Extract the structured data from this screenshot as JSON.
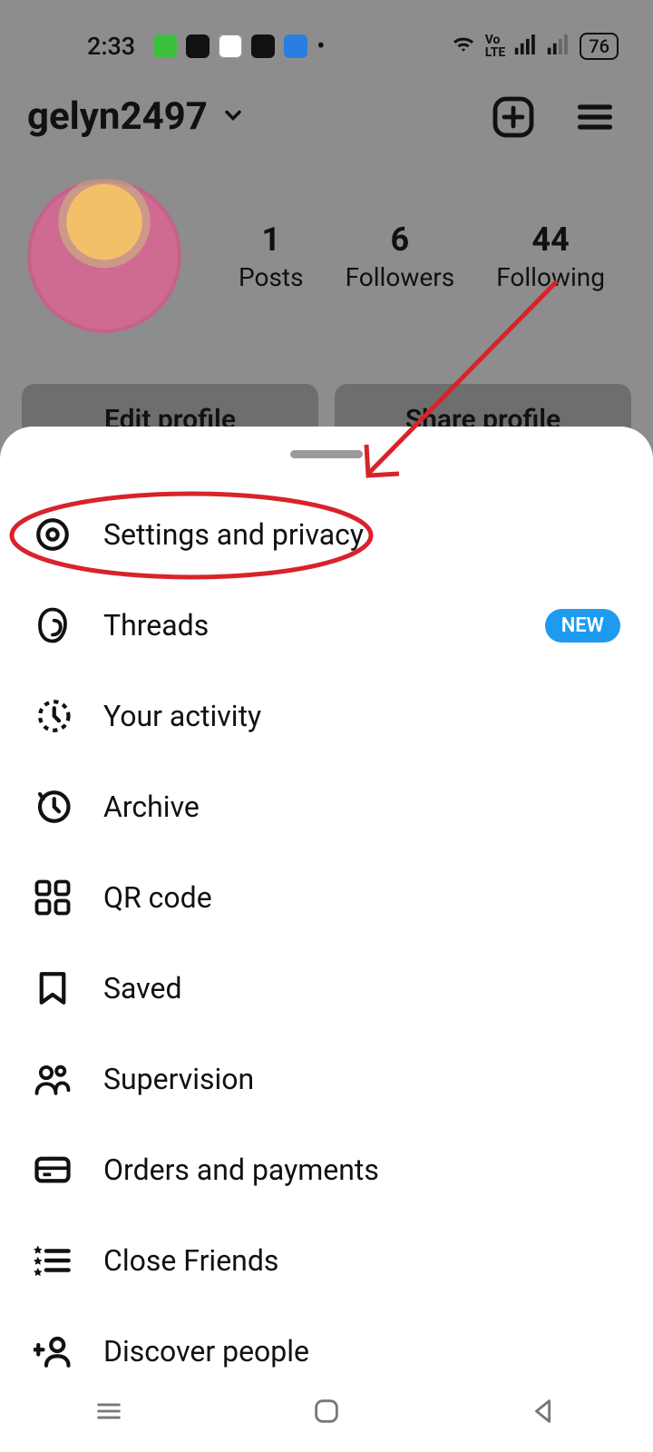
{
  "status": {
    "time": "2:33",
    "battery": "76"
  },
  "profile": {
    "username": "gelyn2497",
    "stats": {
      "posts": {
        "count": "1",
        "label": "Posts"
      },
      "followers": {
        "count": "6",
        "label": "Followers"
      },
      "following": {
        "count": "44",
        "label": "Following"
      }
    },
    "buttons": {
      "edit": "Edit profile",
      "share": "Share profile"
    }
  },
  "menu": {
    "items": [
      {
        "label": "Settings and privacy",
        "icon": "gear-icon",
        "badge": null
      },
      {
        "label": "Threads",
        "icon": "threads-icon",
        "badge": "NEW"
      },
      {
        "label": "Your activity",
        "icon": "activity-icon",
        "badge": null
      },
      {
        "label": "Archive",
        "icon": "archive-icon",
        "badge": null
      },
      {
        "label": "QR code",
        "icon": "qrcode-icon",
        "badge": null
      },
      {
        "label": "Saved",
        "icon": "bookmark-icon",
        "badge": null
      },
      {
        "label": "Supervision",
        "icon": "supervision-icon",
        "badge": null
      },
      {
        "label": "Orders and payments",
        "icon": "card-icon",
        "badge": null
      },
      {
        "label": "Close Friends",
        "icon": "close-friends-icon",
        "badge": null
      },
      {
        "label": "Discover people",
        "icon": "add-person-icon",
        "badge": null
      }
    ]
  }
}
